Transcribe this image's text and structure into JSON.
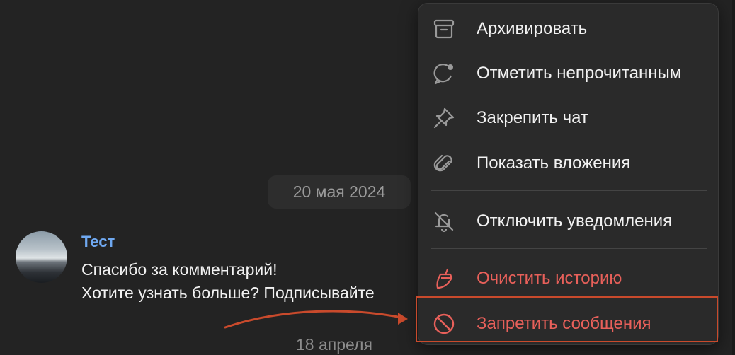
{
  "chat": {
    "date_separator": "20 мая 2024",
    "message": {
      "sender": "Тест",
      "lines": [
        "Спасибо за комментарий!",
        "Хотите узнать больше? Подписывайте"
      ]
    },
    "next_date": "18 апреля"
  },
  "menu": {
    "items": [
      {
        "label": "Архивировать",
        "icon": "archive-icon"
      },
      {
        "label": "Отметить непрочитанным",
        "icon": "mark-unread-icon"
      },
      {
        "label": "Закрепить чат",
        "icon": "pin-icon"
      },
      {
        "label": "Показать вложения",
        "icon": "attachment-icon"
      },
      {
        "label": "Отключить уведомления",
        "icon": "mute-bell-icon"
      },
      {
        "label": "Очистить историю",
        "icon": "broom-icon"
      },
      {
        "label": "Запретить сообщения",
        "icon": "block-icon"
      }
    ]
  },
  "colors": {
    "background": "#232323",
    "menu_background": "#2a2a2a",
    "sender_name": "#6fa8f0",
    "danger": "#e8605a",
    "annotation": "#c94a2c"
  }
}
